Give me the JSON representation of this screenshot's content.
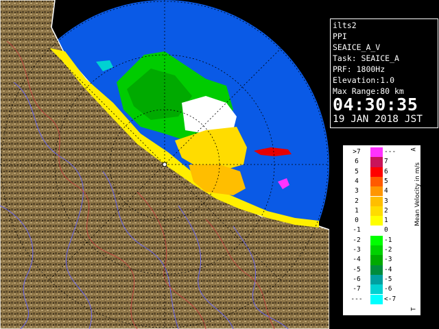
{
  "radar_info": {
    "site": "ilts2",
    "scan_type": "PPI",
    "product": "SEAICE_A_V",
    "task": "Task: SEAICE_A",
    "prf": "PRF: 1800Hz",
    "elevation": "Elevation:1.0",
    "max_range": "Max Range:80 km",
    "time": "04:30:35",
    "date": "19 JAN 2018 JST"
  },
  "legend": {
    "axis_label": "Mean Velocity in m/s",
    "top_letter": "A",
    "bottom_letter": "T",
    "rows": [
      {
        "left": ">7",
        "right": "---",
        "color": "#ff33ff"
      },
      {
        "left": "6",
        "right": "7",
        "color": "#c8145a"
      },
      {
        "left": "5",
        "right": "6",
        "color": "#ff0000"
      },
      {
        "left": "4",
        "right": "5",
        "color": "#ff5a00"
      },
      {
        "left": "3",
        "right": "4",
        "color": "#ff9600"
      },
      {
        "left": "2",
        "right": "3",
        "color": "#ffbe00"
      },
      {
        "left": "1",
        "right": "2",
        "color": "#ffdc00"
      },
      {
        "left": "0",
        "right": "1",
        "color": "#ffff00"
      },
      {
        "left": "-1",
        "right": "0",
        "color": "#ffffff"
      },
      {
        "left": "-2",
        "right": "-1",
        "color": "#00ff00"
      },
      {
        "left": "-3",
        "right": "-2",
        "color": "#00d200"
      },
      {
        "left": "-4",
        "right": "-3",
        "color": "#00aa00"
      },
      {
        "left": "-5",
        "right": "-4",
        "color": "#008c3c"
      },
      {
        "left": "-6",
        "right": "-5",
        "color": "#00a0a0"
      },
      {
        "left": "-7",
        "right": "-6",
        "color": "#00d2d2"
      },
      {
        "left": "---",
        "right": "<-7",
        "color": "#00ffff"
      }
    ]
  },
  "colors": {
    "sea": "#0a5ae6",
    "no_echo": "#0a5ae6",
    "land": "#8a7245",
    "coast_echo": "#ffee00"
  }
}
